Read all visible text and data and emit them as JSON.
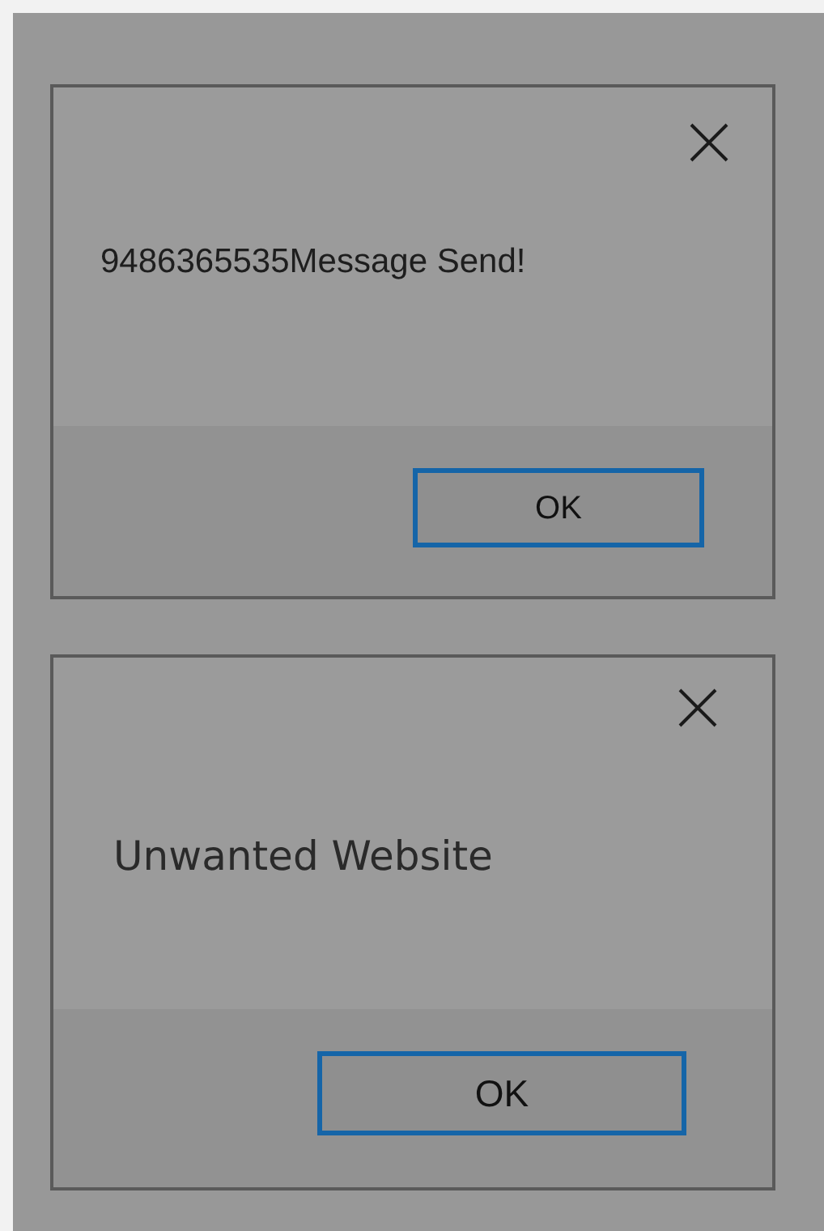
{
  "dialogs": [
    {
      "message": "9486365535Message Send!",
      "ok_button": {
        "label": "OK",
        "focused": true
      }
    },
    {
      "message": "Unwanted Website",
      "ok_button": {
        "label": "OK",
        "focused": true
      }
    }
  ]
}
